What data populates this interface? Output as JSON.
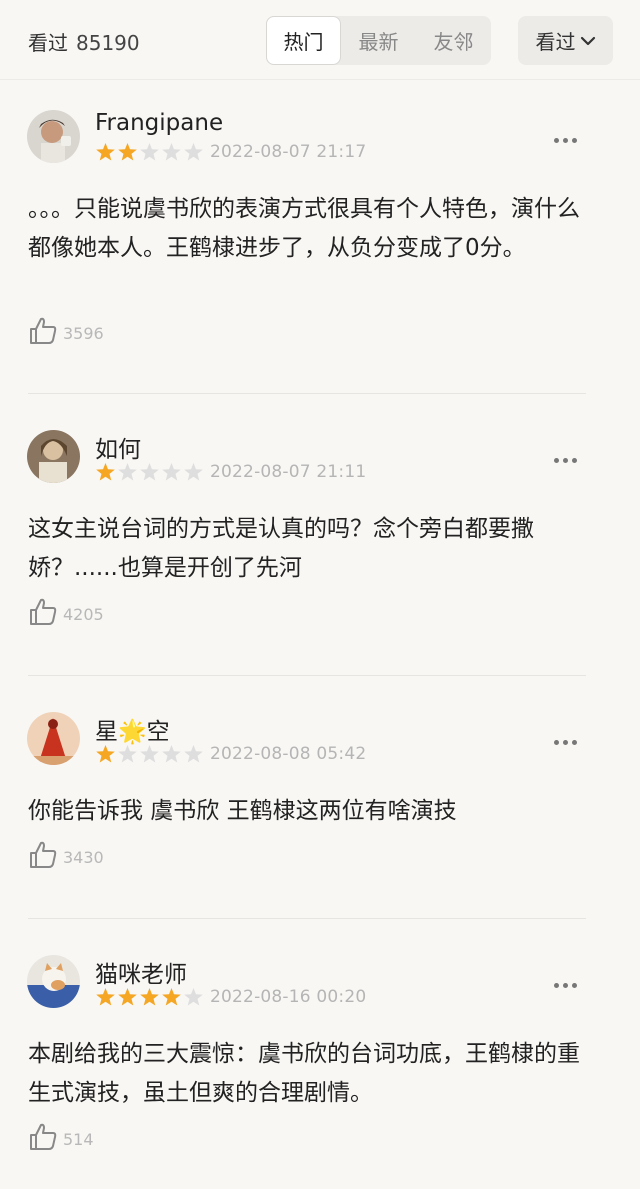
{
  "header": {
    "seen_label": "看过",
    "seen_count": "85190",
    "tabs": [
      {
        "label": "热门",
        "active": true
      },
      {
        "label": "最新",
        "active": false
      },
      {
        "label": "友邻",
        "active": false
      }
    ],
    "dropdown_label": "看过",
    "dropdown_icon": "chevron-down-icon"
  },
  "colors": {
    "star_filled": "#f5a623",
    "star_empty": "#dedede",
    "background": "#f8f7f4"
  },
  "reviews": [
    {
      "user": "Frangipane",
      "rating": 2,
      "date": "2022-08-07 21:17",
      "content": "。。。只能说虞书欣的表演方式很具有个人特色，演什么都像她本人。王鹤棣进步了，从负分变成了0分。",
      "likes": "3596"
    },
    {
      "user": "如何",
      "rating": 1,
      "date": "2022-08-07 21:11",
      "content": "这女主说台词的方式是认真的吗？念个旁白都要撒娇？......也算是开创了先河",
      "likes": "4205"
    },
    {
      "user": "星🌟空",
      "rating": 1,
      "date": "2022-08-08 05:42",
      "content": "你能告诉我 虞书欣 王鹤棣这两位有啥演技",
      "likes": "3430"
    },
    {
      "user": "猫咪老师",
      "rating": 4,
      "date": "2022-08-16 00:20",
      "content": "本剧给我的三大震惊：虞书欣的台词功底，王鹤棣的重生式演技，虽土但爽的合理剧情。",
      "likes": "514"
    }
  ]
}
